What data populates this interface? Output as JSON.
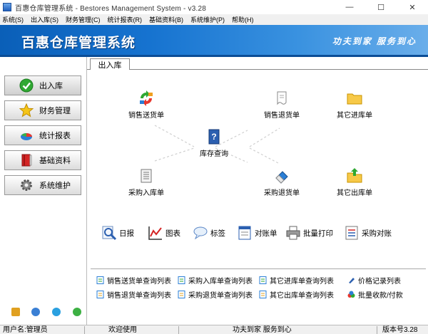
{
  "window": {
    "title": "百惠仓库管理系统 - Bestores Management System - v3.28",
    "controls": [
      "—",
      "☐",
      "✕"
    ]
  },
  "menu": [
    "系统(S)",
    "出入库(S)",
    "财务管理(C)",
    "统计报表(R)",
    "基础资料(B)",
    "系统维护(P)",
    "帮助(H)"
  ],
  "banner": {
    "title": "百惠仓库管理系统",
    "slogan": "功夫到家  服务到心"
  },
  "sidebar": {
    "items": [
      {
        "label": "出入库",
        "icon": "check-icon"
      },
      {
        "label": "财务管理",
        "icon": "star-icon"
      },
      {
        "label": "统计报表",
        "icon": "pie-chart-icon"
      },
      {
        "label": "基础资料",
        "icon": "book-icon"
      },
      {
        "label": "系统维护",
        "icon": "gear-icon"
      }
    ]
  },
  "tab": {
    "label": "出入库"
  },
  "flow": {
    "sales_delivery": "销售送货单",
    "sales_return": "销售退货单",
    "other_in": "其它进库单",
    "stock_query": "库存查询",
    "purchase_in": "采购入库单",
    "purchase_return": "采购退货单",
    "other_out": "其它出库单"
  },
  "tools": {
    "daily": "日报",
    "chart": "图表",
    "label": "标签",
    "reconcile": "对账单",
    "batch_print": "批量打印",
    "purchase_reconcile": "采购对账"
  },
  "links": {
    "row1": [
      "销售送货单查询列表",
      "采购入库单查询列表",
      "其它进库单查询列表",
      "价格记录列表"
    ],
    "row2": [
      "销售退货单查询列表",
      "采购退货单查询列表",
      "其它出库单查询列表",
      "批量收款/付款"
    ]
  },
  "status": {
    "user": "用户名:管理员",
    "welcome": "欢迎使用",
    "slogan": "功夫到家 服务到心",
    "version": "版本号3.28"
  },
  "colors": {
    "banner_dark": "#0a5fb8",
    "banner_light": "#6aaeea"
  }
}
